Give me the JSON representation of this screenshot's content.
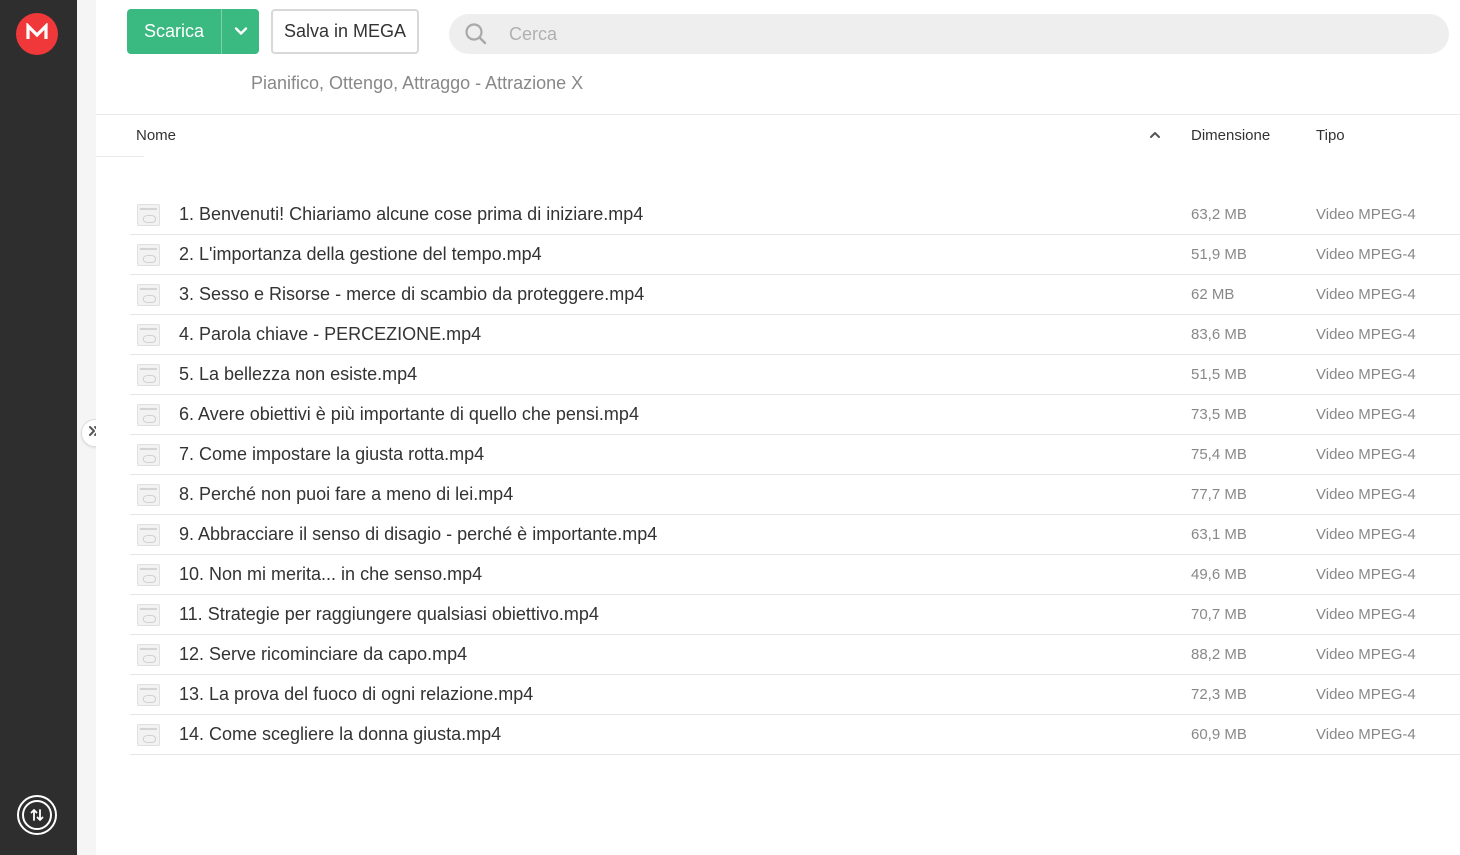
{
  "brand": {
    "logo_letter": "M",
    "accent_color": "#f0373a",
    "sidebar_color": "#2e2e2e"
  },
  "toolbar": {
    "download_label": "Scarica",
    "download_color": "#3ab981",
    "save_label": "Salva in MEGA"
  },
  "search": {
    "placeholder": "Cerca",
    "value": ""
  },
  "folder": {
    "name": "Pianifico, Ottengo, Attraggo - Attrazione X"
  },
  "columns": {
    "name": "Nome",
    "size": "Dimensione",
    "type": "Tipo",
    "sort": "ascending"
  },
  "files": [
    {
      "name": "1. Benvenuti! Chiariamo alcune cose prima di iniziare.mp4",
      "size": "63,2 MB",
      "type": "Video MPEG-4"
    },
    {
      "name": "2. L'importanza della gestione del tempo.mp4",
      "size": "51,9 MB",
      "type": "Video MPEG-4"
    },
    {
      "name": "3. Sesso e Risorse - merce di scambio da proteggere.mp4",
      "size": "62 MB",
      "type": "Video MPEG-4"
    },
    {
      "name": "4. Parola chiave - PERCEZIONE.mp4",
      "size": "83,6 MB",
      "type": "Video MPEG-4"
    },
    {
      "name": "5. La bellezza non esiste.mp4",
      "size": "51,5 MB",
      "type": "Video MPEG-4"
    },
    {
      "name": "6. Avere obiettivi è più importante di quello che pensi.mp4",
      "size": "73,5 MB",
      "type": "Video MPEG-4"
    },
    {
      "name": "7. Come impostare la giusta rotta.mp4",
      "size": "75,4 MB",
      "type": "Video MPEG-4"
    },
    {
      "name": "8. Perché non puoi fare a meno di lei.mp4",
      "size": "77,7 MB",
      "type": "Video MPEG-4"
    },
    {
      "name": "9. Abbracciare il senso di disagio - perché è importante.mp4",
      "size": "63,1 MB",
      "type": "Video MPEG-4"
    },
    {
      "name": "10. Non mi merita... in che senso.mp4",
      "size": "49,6 MB",
      "type": "Video MPEG-4"
    },
    {
      "name": "11. Strategie per raggiungere qualsiasi obiettivo.mp4",
      "size": "70,7 MB",
      "type": "Video MPEG-4"
    },
    {
      "name": "12. Serve ricominciare da capo.mp4",
      "size": "88,2 MB",
      "type": "Video MPEG-4"
    },
    {
      "name": "13. La prova del fuoco di ogni relazione.mp4",
      "size": "72,3 MB",
      "type": "Video MPEG-4"
    },
    {
      "name": "14. Come scegliere la donna giusta.mp4",
      "size": "60,9 MB",
      "type": "Video MPEG-4"
    }
  ]
}
